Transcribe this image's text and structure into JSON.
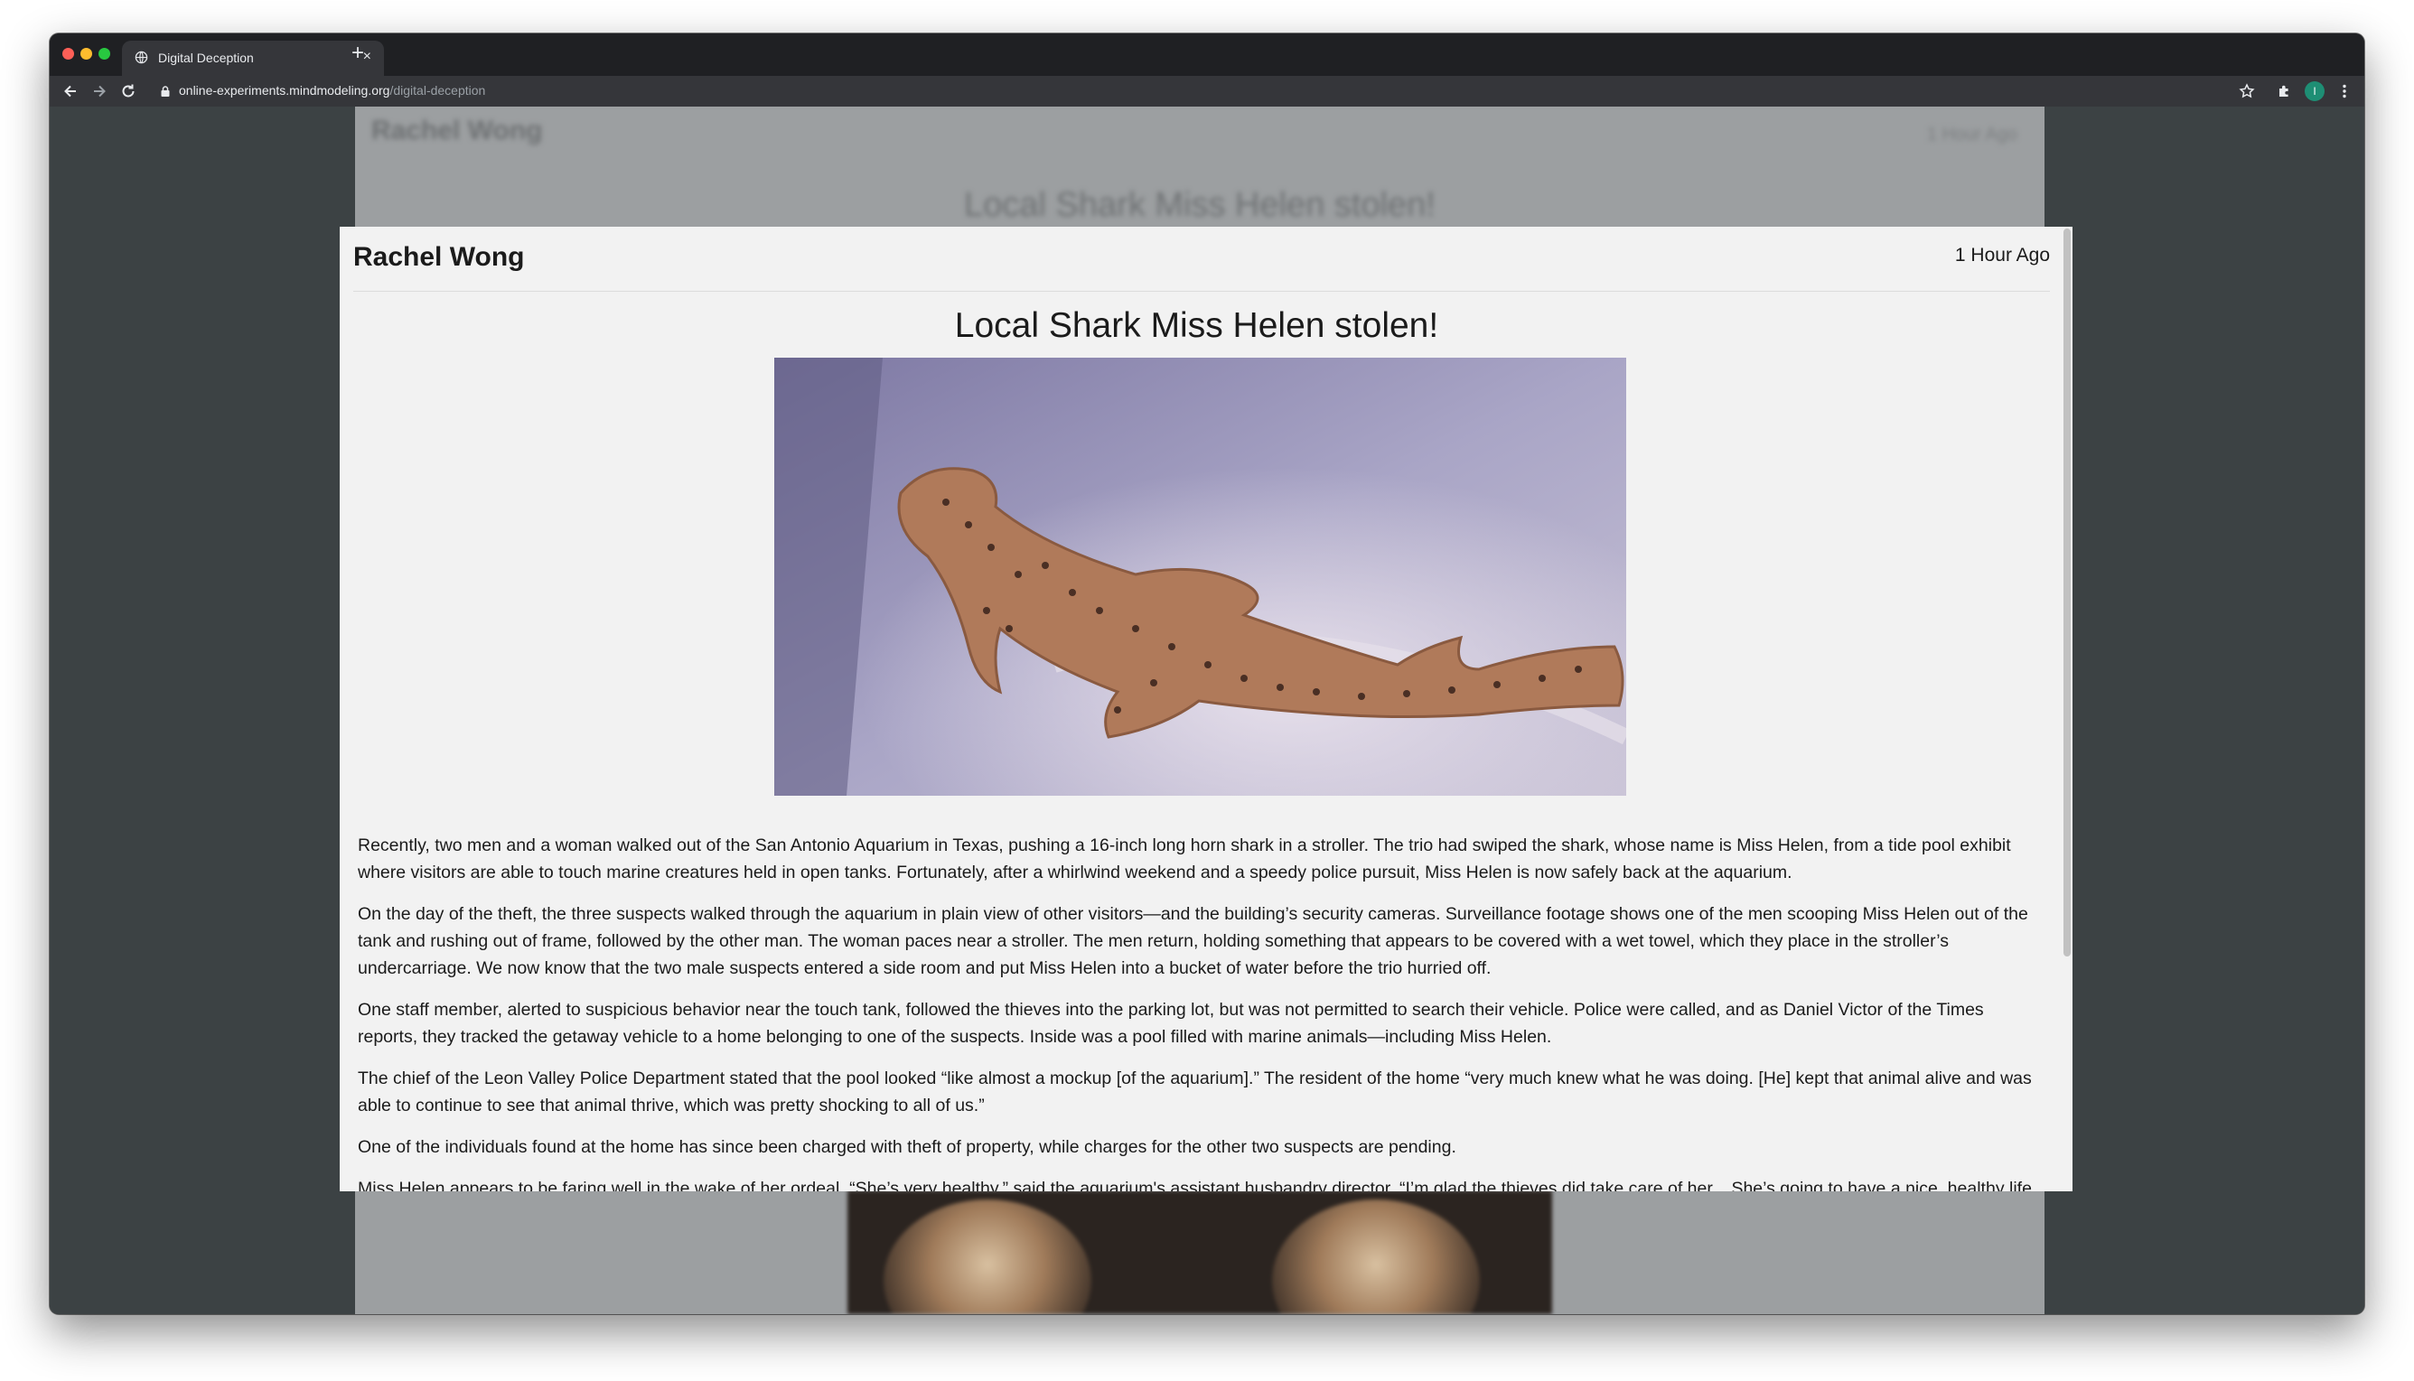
{
  "browser": {
    "tab_title": "Digital Deception",
    "tab_close": "×",
    "new_tab": "+",
    "url_domain": "online-experiments.mindmodeling.org",
    "url_path": "/digital-deception",
    "profile_initial": "I"
  },
  "background_page": {
    "author": "Rachel Wong",
    "timestamp": "1 Hour Ago",
    "headline": "Local Shark Miss Helen stolen!"
  },
  "post": {
    "author": "Rachel Wong",
    "timestamp": "1 Hour Ago",
    "headline": "Local Shark Miss Helen stolen!",
    "paragraphs": [
      "Recently, two men and a woman walked out of the San Antonio Aquarium in Texas, pushing a 16-inch long horn shark in a stroller. The trio had swiped the shark, whose name is Miss Helen, from a tide pool exhibit where visitors are able to touch marine creatures held in open tanks. Fortunately, after a whirlwind weekend and a speedy police pursuit, Miss Helen is now safely back at the aquarium.",
      "On the day of the theft, the three suspects walked through the aquarium in plain view of other visitors—and the building’s security cameras. Surveillance footage shows one of the men scooping Miss Helen out of the tank and rushing out of frame, followed by the other man. The woman paces near a stroller. The men return, holding something that appears to be covered with a wet towel, which they place in the stroller’s undercarriage. We now know that the two male suspects entered a side room and put Miss Helen into a bucket of water before the trio hurried off.",
      "One staff member, alerted to suspicious behavior near the touch tank, followed the thieves into the parking lot, but was not permitted to search their vehicle. Police were called, and as Daniel Victor of the Times reports, they tracked the getaway vehicle to a home belonging to one of the suspects. Inside was a pool filled with marine animals—including Miss Helen.",
      "The chief of the Leon Valley Police Department stated that the pool looked “like almost a mockup [of the aquarium].” The resident of the home “very much knew what he was doing. [He] kept that animal alive and was able to continue to see that animal thrive, which was pretty shocking to all of us.”",
      "One of the individuals found at the home has since been charged with theft of property, while charges for the other two suspects are pending.",
      "Miss Helen appears to be faring well in the wake of her ordeal. “She’s very healthy,” said the aquarium's assistant husbandry director. “I’m glad the thieves did take care of her... She’s going to have a nice, healthy life it"
    ]
  }
}
